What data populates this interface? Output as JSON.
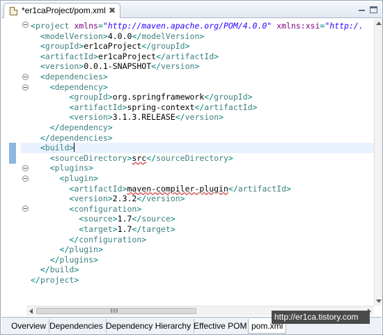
{
  "editor_tab": {
    "title": "*er1caProject/pom.xml",
    "close_glyph": "✖"
  },
  "code_lines": [
    [
      {
        "c": "punc",
        "t": "<"
      },
      {
        "c": "tag",
        "t": "project"
      },
      {
        "c": "txt",
        "t": " "
      },
      {
        "c": "attr",
        "t": "xmlns"
      },
      {
        "c": "punc",
        "t": "="
      },
      {
        "c": "val",
        "t": "\"http://maven.apache.org/POM/4.0.0\""
      },
      {
        "c": "txt",
        "t": " "
      },
      {
        "c": "attr",
        "t": "xmlns:xsi"
      },
      {
        "c": "punc",
        "t": "="
      },
      {
        "c": "val",
        "t": "\"http:/."
      }
    ],
    [
      {
        "c": "punc",
        "t": "  <"
      },
      {
        "c": "tag",
        "t": "modelVersion"
      },
      {
        "c": "punc",
        "t": ">"
      },
      {
        "c": "txt",
        "t": "4.0.0"
      },
      {
        "c": "punc",
        "t": "</"
      },
      {
        "c": "tag",
        "t": "modelVersion"
      },
      {
        "c": "punc",
        "t": ">"
      }
    ],
    [
      {
        "c": "punc",
        "t": "  <"
      },
      {
        "c": "tag",
        "t": "groupId"
      },
      {
        "c": "punc",
        "t": ">"
      },
      {
        "c": "txt",
        "t": "er1caProject"
      },
      {
        "c": "punc",
        "t": "</"
      },
      {
        "c": "tag",
        "t": "groupId"
      },
      {
        "c": "punc",
        "t": ">"
      }
    ],
    [
      {
        "c": "punc",
        "t": "  <"
      },
      {
        "c": "tag",
        "t": "artifactId"
      },
      {
        "c": "punc",
        "t": ">"
      },
      {
        "c": "txt",
        "t": "er1caProject"
      },
      {
        "c": "punc",
        "t": "</"
      },
      {
        "c": "tag",
        "t": "artifactId"
      },
      {
        "c": "punc",
        "t": ">"
      }
    ],
    [
      {
        "c": "punc",
        "t": "  <"
      },
      {
        "c": "tag",
        "t": "version"
      },
      {
        "c": "punc",
        "t": ">"
      },
      {
        "c": "txt",
        "t": "0.0.1-SNAPSHOT"
      },
      {
        "c": "punc",
        "t": "</"
      },
      {
        "c": "tag",
        "t": "version"
      },
      {
        "c": "punc",
        "t": ">"
      }
    ],
    [
      {
        "c": "punc",
        "t": "  <"
      },
      {
        "c": "tag",
        "t": "dependencies"
      },
      {
        "c": "punc",
        "t": ">"
      }
    ],
    [
      {
        "c": "punc",
        "t": "    <"
      },
      {
        "c": "tag",
        "t": "dependency"
      },
      {
        "c": "punc",
        "t": ">"
      }
    ],
    [
      {
        "c": "punc",
        "t": "        <"
      },
      {
        "c": "tag",
        "t": "groupId"
      },
      {
        "c": "punc",
        "t": ">"
      },
      {
        "c": "txt",
        "t": "org.springframework"
      },
      {
        "c": "punc",
        "t": "</"
      },
      {
        "c": "tag",
        "t": "groupId"
      },
      {
        "c": "punc",
        "t": ">"
      }
    ],
    [
      {
        "c": "punc",
        "t": "        <"
      },
      {
        "c": "tag",
        "t": "artifactId"
      },
      {
        "c": "punc",
        "t": ">"
      },
      {
        "c": "txt",
        "t": "spring-context"
      },
      {
        "c": "punc",
        "t": "</"
      },
      {
        "c": "tag",
        "t": "artifactId"
      },
      {
        "c": "punc",
        "t": ">"
      }
    ],
    [
      {
        "c": "punc",
        "t": "        <"
      },
      {
        "c": "tag",
        "t": "version"
      },
      {
        "c": "punc",
        "t": ">"
      },
      {
        "c": "txt",
        "t": "3.1.3.RELEASE"
      },
      {
        "c": "punc",
        "t": "</"
      },
      {
        "c": "tag",
        "t": "version"
      },
      {
        "c": "punc",
        "t": ">"
      }
    ],
    [
      {
        "c": "punc",
        "t": "    </"
      },
      {
        "c": "tag",
        "t": "dependency"
      },
      {
        "c": "punc",
        "t": ">"
      }
    ],
    [
      {
        "c": "punc",
        "t": "  </"
      },
      {
        "c": "tag",
        "t": "dependencies"
      },
      {
        "c": "punc",
        "t": ">"
      }
    ],
    [
      {
        "c": "punc",
        "t": "  <"
      },
      {
        "c": "tag",
        "t": "build"
      },
      {
        "c": "punc",
        "t": ">"
      }
    ],
    [
      {
        "c": "punc",
        "t": "    <"
      },
      {
        "c": "tag",
        "t": "sourceDirectory"
      },
      {
        "c": "punc",
        "t": ">"
      },
      {
        "c": "squig",
        "t": "src"
      },
      {
        "c": "punc",
        "t": "</"
      },
      {
        "c": "tag",
        "t": "sourceDirectory"
      },
      {
        "c": "punc",
        "t": ">"
      }
    ],
    [
      {
        "c": "punc",
        "t": "    <"
      },
      {
        "c": "tag",
        "t": "plugins"
      },
      {
        "c": "punc",
        "t": ">"
      }
    ],
    [
      {
        "c": "punc",
        "t": "      <"
      },
      {
        "c": "tag",
        "t": "plugin"
      },
      {
        "c": "punc",
        "t": ">"
      }
    ],
    [
      {
        "c": "punc",
        "t": "        <"
      },
      {
        "c": "tag",
        "t": "artifactId"
      },
      {
        "c": "punc",
        "t": ">"
      },
      {
        "c": "squig",
        "t": "maven-compiler-plugin"
      },
      {
        "c": "punc",
        "t": "</"
      },
      {
        "c": "tag",
        "t": "artifactId"
      },
      {
        "c": "punc",
        "t": ">"
      }
    ],
    [
      {
        "c": "punc",
        "t": "        <"
      },
      {
        "c": "tag",
        "t": "version"
      },
      {
        "c": "punc",
        "t": ">"
      },
      {
        "c": "txt",
        "t": "2.3.2"
      },
      {
        "c": "punc",
        "t": "</"
      },
      {
        "c": "tag",
        "t": "version"
      },
      {
        "c": "punc",
        "t": ">"
      }
    ],
    [
      {
        "c": "punc",
        "t": "        <"
      },
      {
        "c": "tag",
        "t": "configuration"
      },
      {
        "c": "punc",
        "t": ">"
      }
    ],
    [
      {
        "c": "punc",
        "t": "          <"
      },
      {
        "c": "tag",
        "t": "source"
      },
      {
        "c": "punc",
        "t": ">"
      },
      {
        "c": "txt",
        "t": "1.7"
      },
      {
        "c": "punc",
        "t": "</"
      },
      {
        "c": "tag",
        "t": "source"
      },
      {
        "c": "punc",
        "t": ">"
      }
    ],
    [
      {
        "c": "punc",
        "t": "          <"
      },
      {
        "c": "tag",
        "t": "target"
      },
      {
        "c": "punc",
        "t": ">"
      },
      {
        "c": "txt",
        "t": "1.7"
      },
      {
        "c": "punc",
        "t": "</"
      },
      {
        "c": "tag",
        "t": "target"
      },
      {
        "c": "punc",
        "t": ">"
      }
    ],
    [
      {
        "c": "punc",
        "t": "        </"
      },
      {
        "c": "tag",
        "t": "configuration"
      },
      {
        "c": "punc",
        "t": ">"
      }
    ],
    [
      {
        "c": "punc",
        "t": "      </"
      },
      {
        "c": "tag",
        "t": "plugin"
      },
      {
        "c": "punc",
        "t": ">"
      }
    ],
    [
      {
        "c": "punc",
        "t": "    </"
      },
      {
        "c": "tag",
        "t": "plugins"
      },
      {
        "c": "punc",
        "t": ">"
      }
    ],
    [
      {
        "c": "punc",
        "t": "  </"
      },
      {
        "c": "tag",
        "t": "build"
      },
      {
        "c": "punc",
        "t": ">"
      }
    ],
    [
      {
        "c": "punc",
        "t": "</"
      },
      {
        "c": "tag",
        "t": "project"
      },
      {
        "c": "punc",
        "t": ">"
      }
    ]
  ],
  "scroll_grip": "ⅡⅡⅡ",
  "page_tabs": [
    "Overview",
    "Dependencies",
    "Dependency Hierarchy",
    "Effective POM",
    "pom.xml"
  ],
  "watermark": "http://er1ca.tistory.com"
}
